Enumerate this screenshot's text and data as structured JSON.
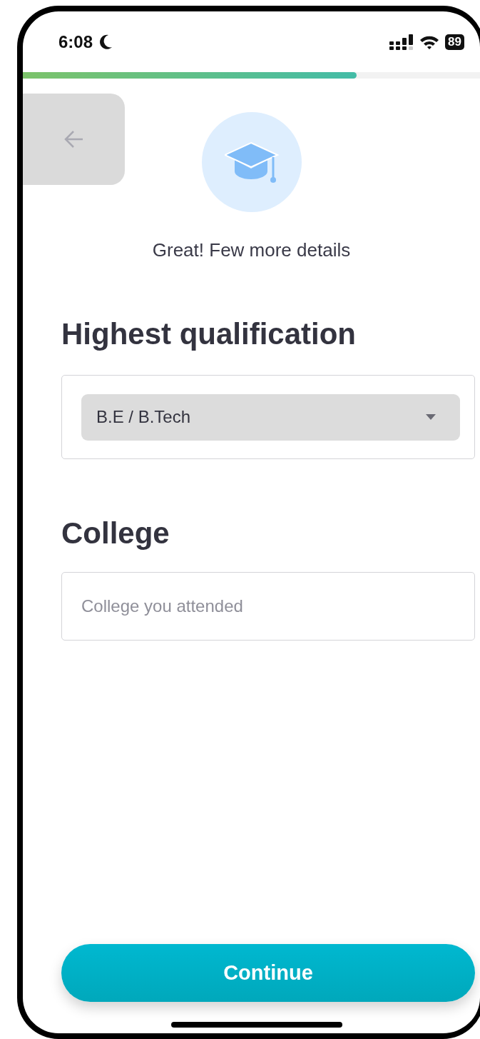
{
  "status_bar": {
    "time": "6:08",
    "battery": "89"
  },
  "progress": {
    "level": 0.73
  },
  "subtitle": "Great! Few more details",
  "fields": [
    {
      "kind": "select",
      "label": "Highest qualification",
      "value": "B.E / B.Tech"
    },
    {
      "kind": "text",
      "label": "College",
      "placeholder": "College you attended"
    }
  ],
  "button": "Continue"
}
